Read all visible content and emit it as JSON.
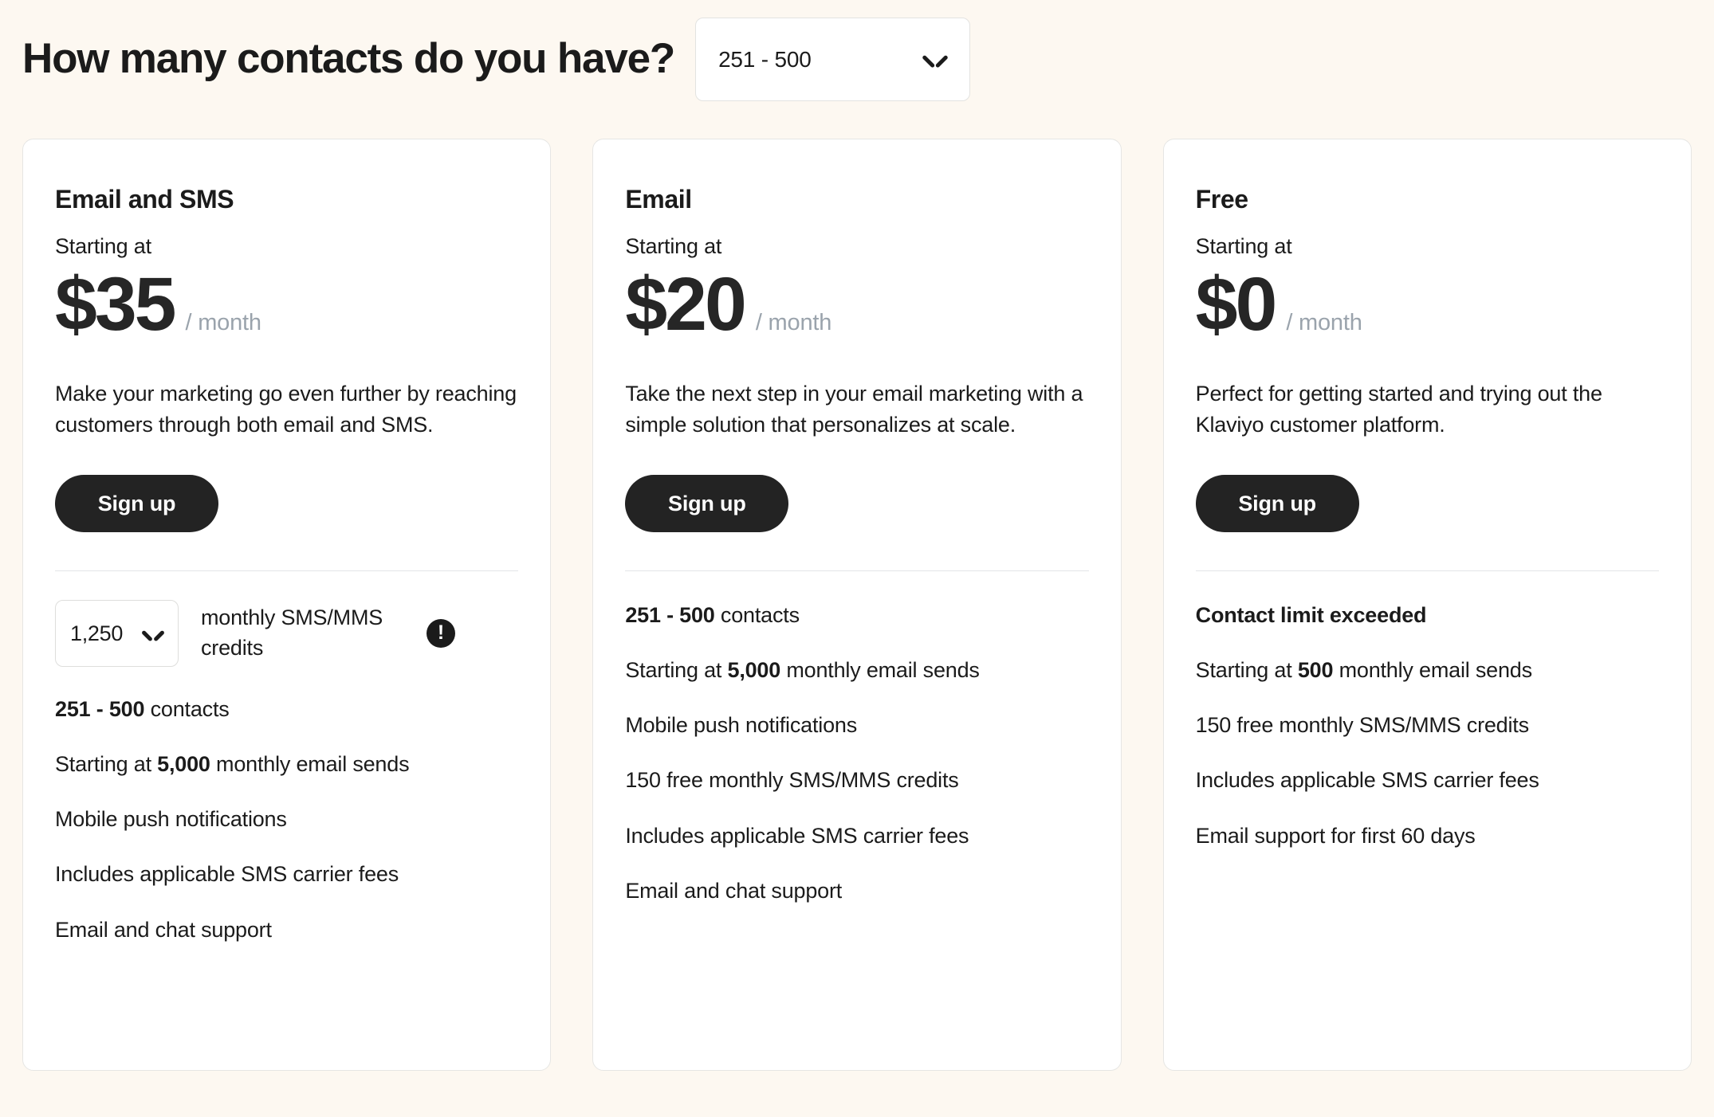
{
  "header": {
    "title": "How many contacts do you have?",
    "contacts_select": {
      "value": "251 - 500",
      "icon": "chevron-down-icon"
    }
  },
  "theme": {
    "background": "#FDF8F1",
    "card_background": "#FFFFFF",
    "card_border": "#E6E6E4",
    "button_background": "#232323",
    "button_text": "#FFFFFF",
    "period_text": "#9AA3AC",
    "divider": "#E2E5E8"
  },
  "plans": [
    {
      "name": "Email and SMS",
      "starting_at_label": "Starting at",
      "price": "$35",
      "period": "/ month",
      "description": "Make your marketing go even further by reaching customers through both email and SMS.",
      "cta_label": "Sign up",
      "credits_selector": {
        "value": "1,250",
        "label": "monthly SMS/MMS credits",
        "info_icon": "exclamation-circle-icon",
        "chevron_icon": "chevron-down-icon"
      },
      "features": [
        {
          "bold_prefix": "251 - 500",
          "text": " contacts"
        },
        {
          "prefix": "Starting at ",
          "bold_mid": "5,000",
          "text": " monthly email sends"
        },
        {
          "text": "Mobile push notifications"
        },
        {
          "text": "Includes applicable SMS carrier fees"
        },
        {
          "text": "Email and chat support"
        }
      ]
    },
    {
      "name": "Email",
      "starting_at_label": "Starting at",
      "price": "$20",
      "period": "/ month",
      "description": "Take the next step in your email marketing with a simple solution that personalizes at scale.",
      "cta_label": "Sign up",
      "features": [
        {
          "bold_prefix": "251 - 500",
          "text": " contacts"
        },
        {
          "prefix": "Starting at ",
          "bold_mid": "5,000",
          "text": " monthly email sends"
        },
        {
          "text": "Mobile push notifications"
        },
        {
          "text": "150 free monthly SMS/MMS credits"
        },
        {
          "text": "Includes applicable SMS carrier fees"
        },
        {
          "text": "Email and chat support"
        }
      ]
    },
    {
      "name": "Free",
      "starting_at_label": "Starting at",
      "price": "$0",
      "period": "/ month",
      "description": "Perfect for getting started and trying out the Klaviyo customer platform.",
      "cta_label": "Sign up",
      "features": [
        {
          "bold_prefix": "Contact limit exceeded",
          "text": ""
        },
        {
          "prefix": "Starting at ",
          "bold_mid": "500",
          "text": " monthly email sends"
        },
        {
          "text": "150 free monthly SMS/MMS credits"
        },
        {
          "text": "Includes applicable SMS carrier fees"
        },
        {
          "text": "Email support for first 60 days"
        }
      ]
    }
  ]
}
